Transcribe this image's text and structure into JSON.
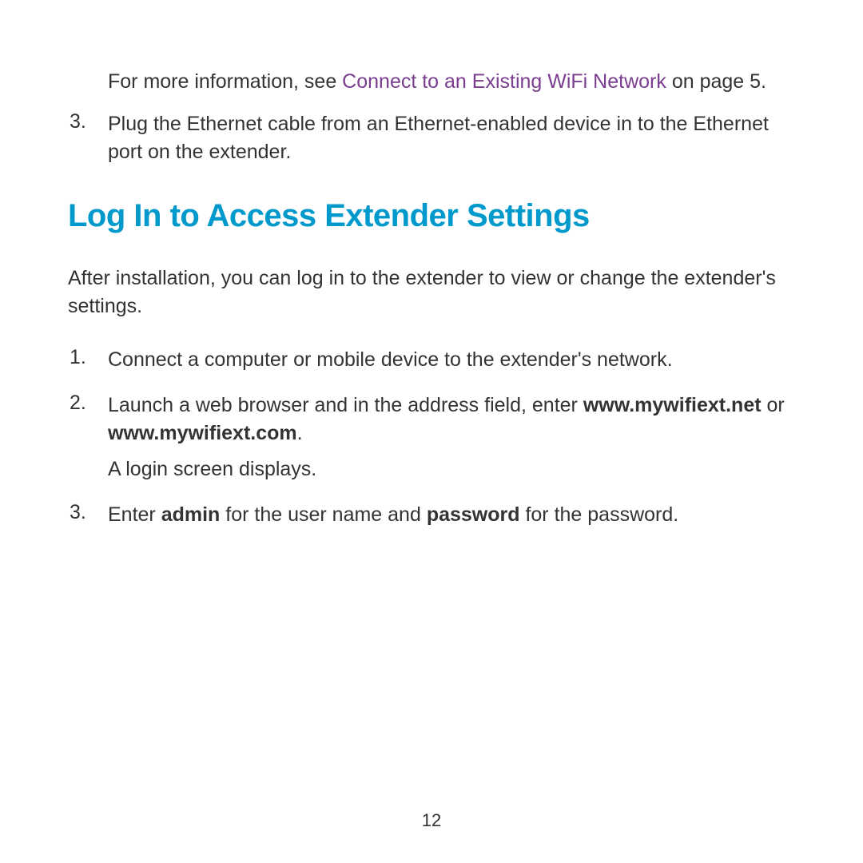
{
  "top": {
    "continuation_prefix": "For more information, see ",
    "link_text": "Connect to an Existing WiFi Network",
    "continuation_suffix": " on page 5.",
    "item3_number": "3.",
    "item3_text": "Plug the Ethernet cable from an Ethernet-enabled device in to the Ethernet port on the extender."
  },
  "heading": "Log In to Access Extender Settings",
  "intro": "After installation, you can log in to the extender to view or change the extender's settings.",
  "steps": {
    "s1_number": "1.",
    "s1_text": "Connect a computer or mobile device to the extender's network.",
    "s2_number": "2.",
    "s2_prefix": "Launch a web browser and in the address field, enter ",
    "s2_bold1": "www.mywifiext.net",
    "s2_mid": " or ",
    "s2_bold2": "www.mywifiext.com",
    "s2_suffix": ".",
    "s2_line2": "A login screen displays.",
    "s3_number": "3.",
    "s3_prefix": "Enter ",
    "s3_bold1": "admin",
    "s3_mid": " for the user name and ",
    "s3_bold2": "password",
    "s3_suffix": " for the password."
  },
  "page_number": "12"
}
